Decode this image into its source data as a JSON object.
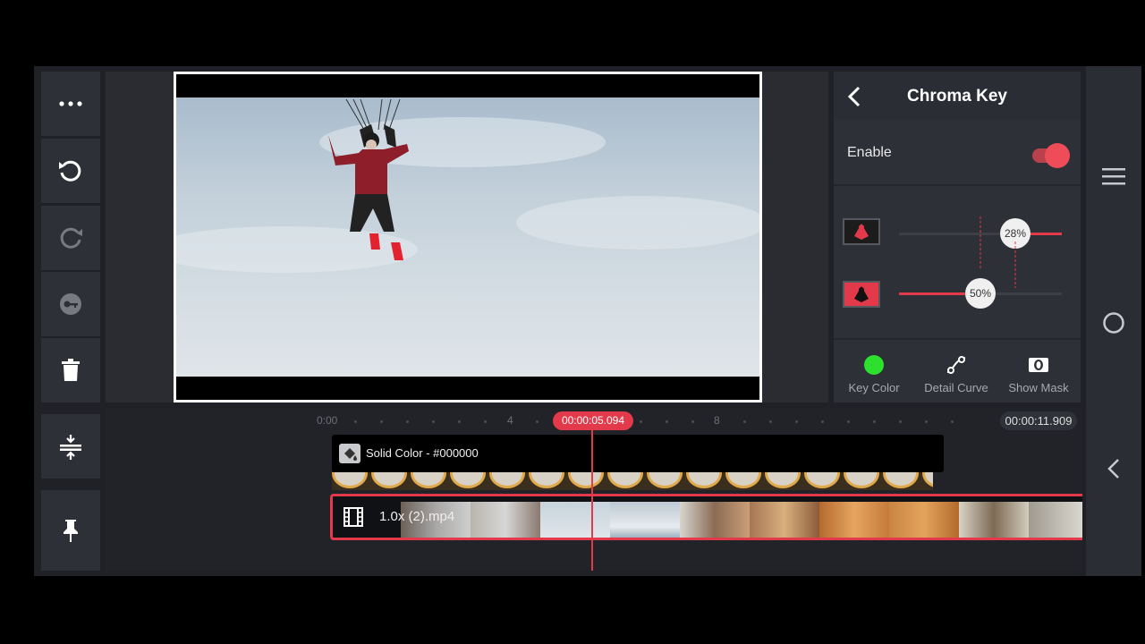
{
  "toolbar": {
    "items": [
      {
        "icon": "more-icon",
        "enabled": true
      },
      {
        "icon": "undo-icon",
        "enabled": true
      },
      {
        "icon": "redo-icon",
        "enabled": false
      },
      {
        "icon": "keyframe-icon",
        "enabled": false
      },
      {
        "icon": "delete-icon",
        "enabled": true
      }
    ],
    "bottom": [
      {
        "icon": "timeline-zoom-icon"
      },
      {
        "icon": "pin-icon"
      }
    ]
  },
  "panel": {
    "title": "Chroma Key",
    "enable_label": "Enable",
    "enabled": true,
    "slider_top_value": "28%",
    "slider_top_fraction": 0.28,
    "slider_bottom_value": "50%",
    "slider_bottom_fraction": 0.5,
    "buttons": [
      {
        "label": "Key Color",
        "icon": "green-dot-icon"
      },
      {
        "label": "Detail Curve",
        "icon": "curve-icon"
      },
      {
        "label": "Show Mask",
        "icon": "mask-icon"
      }
    ]
  },
  "timeline": {
    "ruler_labels": [
      "0:00",
      "4",
      "8"
    ],
    "playhead_time": "00:00:05.094",
    "end_time": "00:00:11.909",
    "solid_layer_label": "Solid Color - #000000",
    "main_clip_label": "1.0x  (2).mp4"
  },
  "colors": {
    "accent": "#e23a4a",
    "key_color": "#2ee02e"
  },
  "navbar": {
    "icons": [
      "menu-icon",
      "home-icon",
      "back-icon"
    ]
  }
}
